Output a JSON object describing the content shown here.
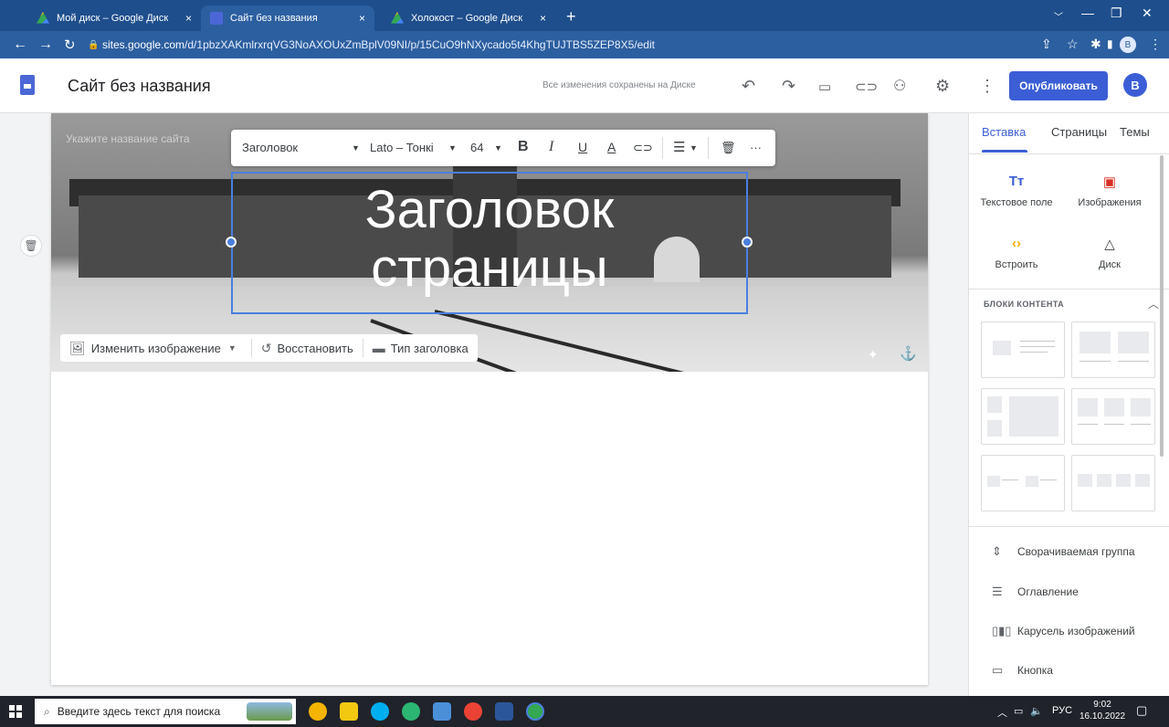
{
  "browser": {
    "tabs": [
      {
        "label": "Мой диск – Google Диск",
        "close": "×"
      },
      {
        "label": "Сайт без названия",
        "close": "×"
      },
      {
        "label": "Холокост – Google Диск",
        "close": "×"
      }
    ],
    "new_tab": "+",
    "url_host": "sites.google.com",
    "url_path": "/d/1pbzXAKmlrxrqVG3NoAXOUxZmBplV09NI/p/15CuO9hNXycado5t4KhgTUJTBS5ZEP8X5/edit",
    "profile_letter": "B"
  },
  "app": {
    "site_title": "Сайт без названия",
    "saved_status": "Все изменения сохранены на Диске",
    "publish_label": "Опубликовать",
    "avatar_letter": "B"
  },
  "editor": {
    "site_name_placeholder": "Укажите название сайта",
    "toolbar": {
      "style": "Заголовок",
      "font": "Lato – Тонкі",
      "size": "64",
      "bold": "B",
      "italic": "I",
      "underline": "U",
      "text_color": "A",
      "more": "···"
    },
    "heading_line1": "Заголовок",
    "heading_line2": "страницы",
    "image_toolbar": {
      "change_image": "Изменить изображение",
      "restore": "Восстановить",
      "header_type": "Тип заголовка"
    }
  },
  "panel": {
    "tabs": [
      "Вставка",
      "Страницы",
      "Темы"
    ],
    "insert": [
      {
        "label": "Текстовое поле",
        "icon": "text-box-icon"
      },
      {
        "label": "Изображения",
        "icon": "image-icon"
      },
      {
        "label": "Встроить",
        "icon": "embed-icon"
      },
      {
        "label": "Диск",
        "icon": "drive-icon"
      }
    ],
    "blocks_heading": "БЛОКИ КОНТЕНТА",
    "list": [
      {
        "label": "Сворачиваемая группа"
      },
      {
        "label": "Оглавление"
      },
      {
        "label": "Карусель изображений"
      },
      {
        "label": "Кнопка"
      }
    ]
  },
  "taskbar": {
    "search_placeholder": "Введите здесь текст для поиска",
    "lang": "РУС",
    "time": "9:02",
    "date": "16.10.2022"
  },
  "colors": {
    "accent": "#3b5ed6",
    "chrome_dark": "#1e4e8c",
    "chrome_light": "#2c5fa0"
  }
}
